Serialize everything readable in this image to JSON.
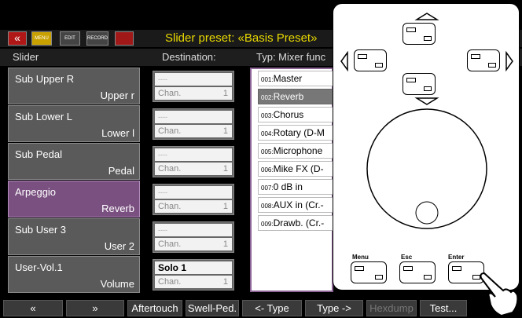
{
  "title": "Slider preset: «Basis Preset»",
  "toolbar": {
    "icon_labels": [
      "",
      "MENU",
      "EDIT",
      "RECORD",
      ""
    ]
  },
  "columns": {
    "slider": "Slider",
    "destination": "Destination:",
    "type": "Typ:  Mixer func"
  },
  "sliders": [
    {
      "name": "Sub Upper R",
      "target": "Upper r",
      "active": false
    },
    {
      "name": "Sub Lower L",
      "target": "Lower l",
      "active": false
    },
    {
      "name": "Sub Pedal",
      "target": "Pedal",
      "active": false
    },
    {
      "name": "Arpeggio",
      "target": "Reverb",
      "active": true
    },
    {
      "name": "Sub User 3",
      "target": "User 2",
      "active": false
    },
    {
      "name": "User-Vol.1",
      "target": "Volume",
      "active": false
    }
  ],
  "destinations": [
    {
      "top": "----",
      "chan": "Chan.",
      "num": "1"
    },
    {
      "top": "----",
      "chan": "Chan.",
      "num": "1"
    },
    {
      "top": "----",
      "chan": "Chan.",
      "num": "1"
    },
    {
      "top": "----",
      "chan": "Chan.",
      "num": "1"
    },
    {
      "top": "----",
      "chan": "Chan.",
      "num": "1"
    },
    {
      "top": "Solo 1",
      "chan": "Chan.",
      "num": "1"
    }
  ],
  "functions": [
    {
      "no": "001:",
      "label": "Master"
    },
    {
      "no": "002:",
      "label": "Reverb"
    },
    {
      "no": "003:",
      "label": "Chorus"
    },
    {
      "no": "004:",
      "label": "Rotary (D-M"
    },
    {
      "no": "005:",
      "label": "Microphone"
    },
    {
      "no": "006:",
      "label": "Mike FX (D-"
    },
    {
      "no": "007:",
      "label": "0 dB in"
    },
    {
      "no": "008:",
      "label": "AUX in (Cr.-"
    },
    {
      "no": "009:",
      "label": "Drawb. (Cr.-"
    }
  ],
  "selected_function": 1,
  "footer": {
    "buttons": [
      "«",
      "»",
      "Aftertouch",
      "Swell-Ped.",
      "<- Type",
      "Type ->",
      "Hexdump",
      "Test..."
    ],
    "disabled": [
      false,
      false,
      false,
      false,
      false,
      false,
      true,
      false
    ]
  },
  "panel": {
    "menu": "Menu",
    "esc": "Esc",
    "enter": "Enter"
  },
  "colors": {
    "accent": "#e8d800",
    "selected_slider": "#7a5080",
    "list_border": "#8c6496"
  }
}
